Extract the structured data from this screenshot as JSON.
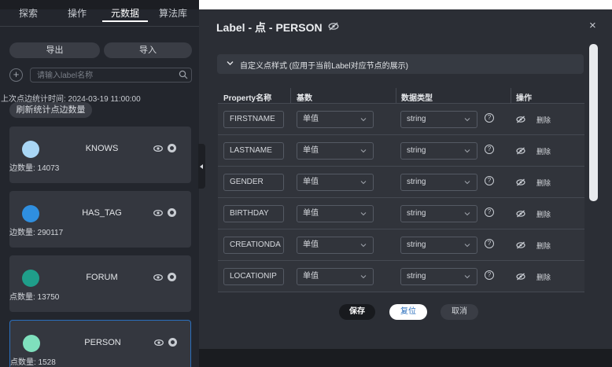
{
  "nav": {
    "tabs": [
      {
        "label": "探索"
      },
      {
        "label": "操作"
      },
      {
        "label": "元数据"
      },
      {
        "label": "算法库"
      }
    ],
    "active_tab": "元数据"
  },
  "sidebar": {
    "export_label": "导出",
    "import_label": "导入",
    "add_symbol": "+",
    "search_placeholder": "请输入label名称",
    "last_stat_time": "上次点边统计时间: 2024-03-19 11:00:00",
    "refresh_label": "刷新统计点边数量",
    "cards": [
      {
        "name": "KNOWS",
        "count": "边数量: 14073",
        "color": "#a9d6f5"
      },
      {
        "name": "HAS_TAG",
        "count": "边数量: 290117",
        "color": "#2f8fe0"
      },
      {
        "name": "FORUM",
        "count": "点数量: 13750",
        "color": "#1f9e8a"
      },
      {
        "name": "PERSON",
        "count": "点数量: 1528",
        "color": "#7fe0bd",
        "selected": true
      }
    ]
  },
  "modal": {
    "title": "Label - 点 - PERSON",
    "close_symbol": "×",
    "section_title": "自定义点样式 (应用于当前Label对应节点的展示)",
    "table": {
      "headers": [
        "Property名称",
        "基数",
        "数据类型",
        "操作"
      ],
      "help_symbol": "?",
      "rows": [
        {
          "property": "FIRSTNAME",
          "cardinality": "单值",
          "data_type": "string",
          "delete": "删除"
        },
        {
          "property": "LASTNAME",
          "cardinality": "单值",
          "data_type": "string",
          "delete": "删除"
        },
        {
          "property": "GENDER",
          "cardinality": "单值",
          "data_type": "string",
          "delete": "删除"
        },
        {
          "property": "BIRTHDAY",
          "cardinality": "单值",
          "data_type": "string",
          "delete": "删除"
        },
        {
          "property": "CREATIONDA",
          "cardinality": "单值",
          "data_type": "string",
          "delete": "删除"
        },
        {
          "property": "LOCATIONIP",
          "cardinality": "单值",
          "data_type": "string",
          "delete": "删除"
        }
      ]
    },
    "save_label": "保存",
    "reset_label": "复位",
    "cancel_label": "取消"
  },
  "colors": {
    "accent": "#2b6fbd",
    "panel": "#23262d",
    "card": "#34373f",
    "modal": "#2b2e35"
  }
}
